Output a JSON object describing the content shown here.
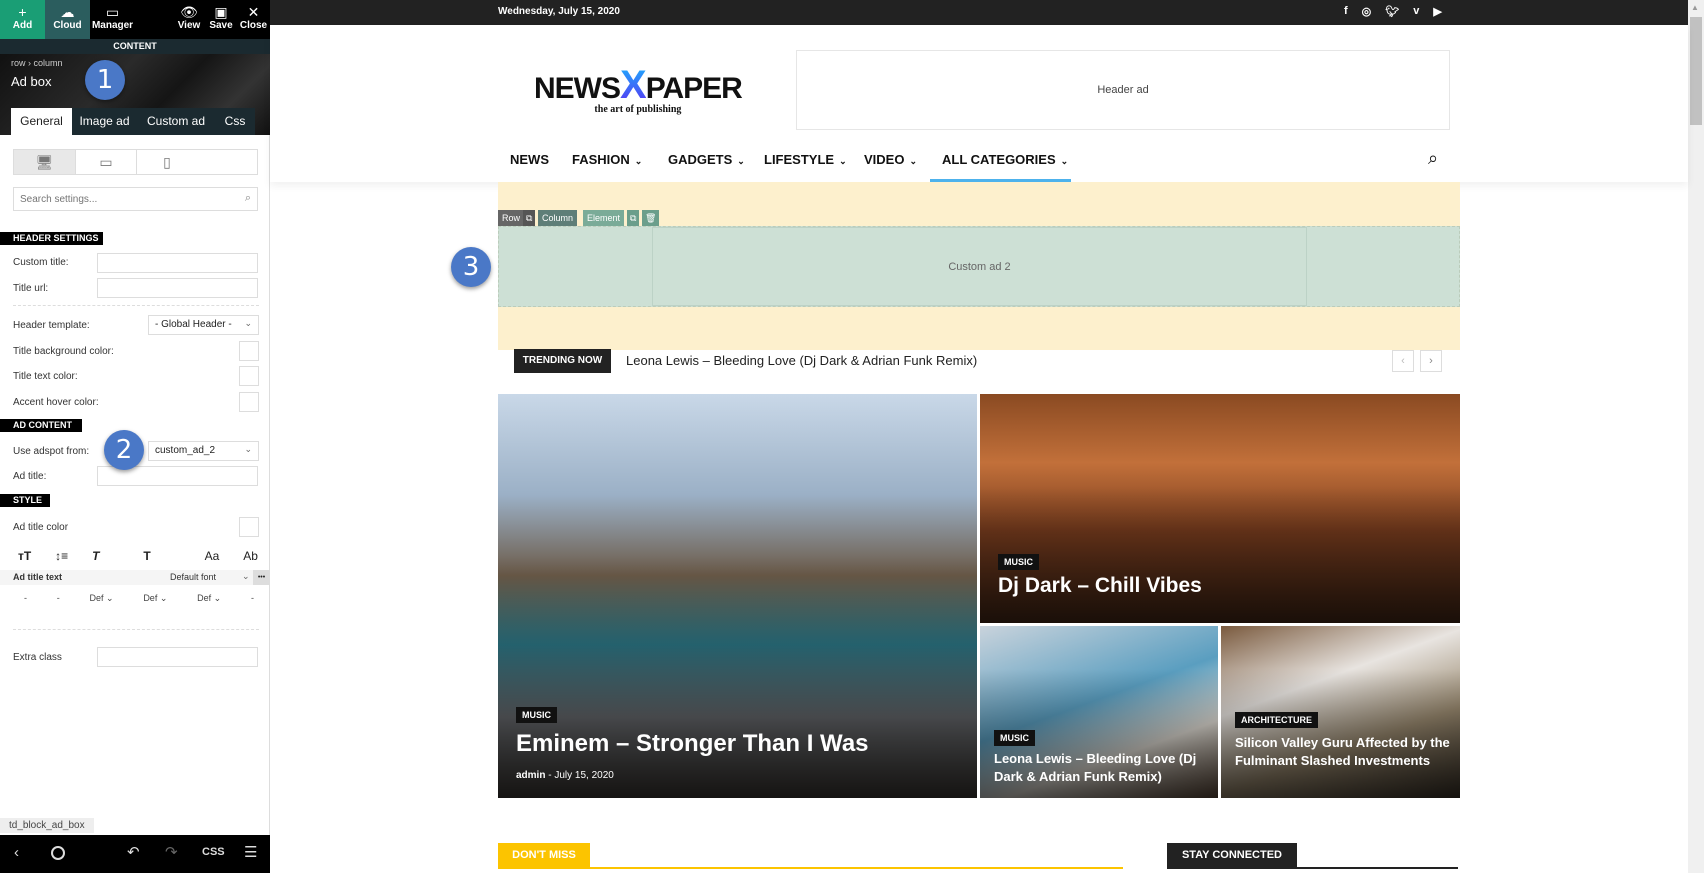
{
  "panel": {
    "toolbar": {
      "add": "Add",
      "cloud": "Cloud",
      "manager": "Manager",
      "view": "View",
      "save": "Save",
      "close": "Close"
    },
    "section_title": "CONTENT",
    "breadcrumb": {
      "row": "row",
      "sep": "›",
      "column": "column"
    },
    "element_title": "Ad box",
    "tabs": [
      "General",
      "Image ad",
      "Custom ad",
      "Css"
    ],
    "search_placeholder": "Search settings...",
    "header_settings": {
      "label": "HEADER SETTINGS",
      "custom_title": "Custom title:",
      "title_url": "Title url:",
      "header_template": "Header template:",
      "header_template_value": "- Global Header -",
      "title_bg_color": "Title background color:",
      "title_text_color": "Title text color:",
      "accent_hover_color": "Accent hover color:"
    },
    "ad_content": {
      "label": "AD CONTENT",
      "use_adspot": "Use adspot from:",
      "use_adspot_value": "custom_ad_2",
      "ad_title": "Ad title:"
    },
    "style": {
      "label": "STYLE",
      "ad_title_color": "Ad title color",
      "ad_title_text": "Ad title text",
      "font_value": "Default font",
      "more": "•••",
      "row": [
        "-",
        "-",
        "Def",
        "Def",
        "Def",
        "-"
      ],
      "extra_class": "Extra class"
    },
    "element_id": "td_block_ad_box",
    "bottom": {
      "css": "CSS"
    }
  },
  "badges": [
    "1",
    "2",
    "3"
  ],
  "site": {
    "date": "Wednesday, July 15, 2020",
    "social": [
      "facebook-icon",
      "instagram-icon",
      "twitter-icon",
      "vimeo-icon",
      "youtube-icon"
    ],
    "logo": {
      "left": "NEWS",
      "x": "X",
      "right": "PAPER",
      "tagline": "the art of publishing"
    },
    "header_ad": "Header ad",
    "nav": [
      {
        "label": "NEWS",
        "dd": false
      },
      {
        "label": "FASHION",
        "dd": true
      },
      {
        "label": "GADGETS",
        "dd": true
      },
      {
        "label": "LIFESTYLE",
        "dd": true
      },
      {
        "label": "VIDEO",
        "dd": true
      },
      {
        "label": "ALL CATEGORIES",
        "dd": true
      }
    ],
    "builder_toolbar": {
      "row": "Row",
      "column": "Column",
      "element": "Element"
    },
    "custom_ad": "Custom ad 2",
    "trending": {
      "label": "TRENDING NOW",
      "text": "Leona Lewis – Bleeding Love (Dj Dark & Adrian Funk Remix)",
      "prev": "‹",
      "next": "›"
    },
    "cards": [
      {
        "cat": "MUSIC",
        "title": "Eminem – Stronger Than I Was",
        "author": "admin",
        "date": "July 15, 2020"
      },
      {
        "cat": "MUSIC",
        "title": "Dj Dark – Chill Vibes"
      },
      {
        "cat": "MUSIC",
        "title": "Leona Lewis – Bleeding Love (Dj Dark & Adrian Funk Remix)"
      },
      {
        "cat": "ARCHITECTURE",
        "title": "Silicon Valley Guru Affected by the Fulminant Slashed Investments"
      }
    ],
    "dont_miss": "DON'T MISS",
    "stay_connected": "STAY CONNECTED"
  },
  "colors": {
    "add_green": "#1a9e75",
    "cloud_teal": "#2b5d5e",
    "accent_blue": "#4db2ec",
    "dont_miss": "#fcc400",
    "ad_area": "#fdf0cd",
    "element": "#cde0d5"
  }
}
